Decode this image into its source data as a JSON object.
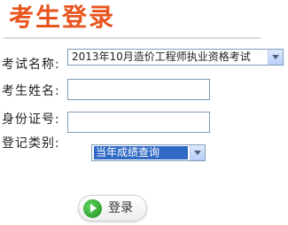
{
  "header": {
    "title": "考生登录"
  },
  "form": {
    "exam_name": {
      "label": "考试名称:",
      "selected": "2013年10月造价工程师执业资格考试"
    },
    "name": {
      "label": "考生姓名:",
      "value": ""
    },
    "id_number": {
      "label": "身份证号:",
      "value": ""
    },
    "category": {
      "label": "登记类别:",
      "selected": "当年成绩查询"
    }
  },
  "actions": {
    "login_label": "登录"
  },
  "colors": {
    "title": "#e8541e",
    "selection_highlight": "#316ac5",
    "login_icon": "#2a9d2a"
  },
  "icons": {
    "login": "arrow-right-circle-icon",
    "dropdown": "chevron-down-icon"
  }
}
